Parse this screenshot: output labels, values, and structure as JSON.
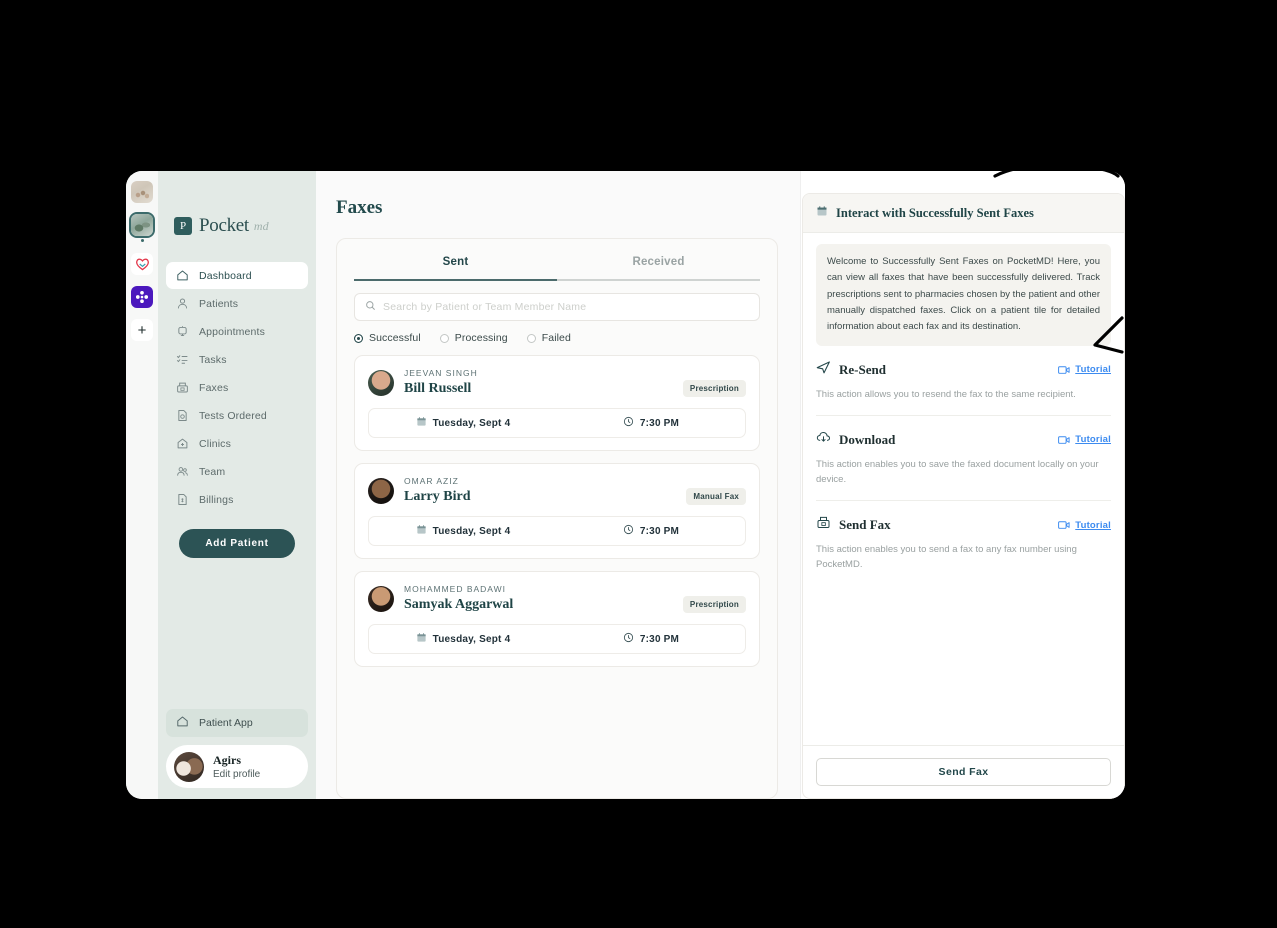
{
  "colors": {
    "brand_teal": "#2c5355",
    "sidebar_bg": "#e3eae6",
    "accent_link": "#3c8bf0",
    "badge_bg": "#efefea",
    "purple_tile": "#4b18bd"
  },
  "rail": {
    "tiles": [
      {
        "name": "workspace-thumb-1",
        "selected": false
      },
      {
        "name": "workspace-thumb-2",
        "selected": true
      },
      {
        "name": "workspace-heart-logo",
        "selected": false
      },
      {
        "name": "workspace-cross-logo",
        "selected": false
      }
    ],
    "add_label": "+"
  },
  "sidebar": {
    "logo": {
      "mark": "P",
      "text": "Pocket",
      "script": "md"
    },
    "items": [
      {
        "label": "Dashboard",
        "icon": "home-icon",
        "active": true
      },
      {
        "label": "Patients",
        "icon": "user-icon",
        "active": false
      },
      {
        "label": "Appointments",
        "icon": "calendar-clock-icon",
        "active": false
      },
      {
        "label": "Tasks",
        "icon": "checklist-icon",
        "active": false
      },
      {
        "label": "Faxes",
        "icon": "fax-icon",
        "active": false
      },
      {
        "label": "Tests Ordered",
        "icon": "lab-document-icon",
        "active": false
      },
      {
        "label": "Clinics",
        "icon": "clinic-icon",
        "active": false
      },
      {
        "label": "Team",
        "icon": "team-icon",
        "active": false
      },
      {
        "label": "Billings",
        "icon": "billing-document-icon",
        "active": false
      }
    ],
    "add_patient_label": "Add Patient",
    "patient_app_label": "Patient App",
    "profile": {
      "name": "Agirs",
      "subtitle": "Edit profile"
    }
  },
  "main": {
    "page_title": "Faxes",
    "tabs": [
      {
        "label": "Sent",
        "active": true
      },
      {
        "label": "Received",
        "active": false
      }
    ],
    "search": {
      "value": "",
      "placeholder": "Search by Patient or Team Member Name"
    },
    "filters": [
      {
        "label": "Successful",
        "selected": true
      },
      {
        "label": "Processing",
        "selected": false
      },
      {
        "label": "Failed",
        "selected": false
      }
    ],
    "faxes": [
      {
        "sender": "JEEVAN SINGH",
        "patient": "Bill Russell",
        "badge": "Prescription",
        "date": "Tuesday, Sept 4",
        "time": "7:30 PM"
      },
      {
        "sender": "OMAR AZIZ",
        "patient": "Larry Bird",
        "badge": "Manual Fax",
        "date": "Tuesday, Sept 4",
        "time": "7:30 PM"
      },
      {
        "sender": "MOHAMMED BADAWI",
        "patient": "Samyak Aggarwal",
        "badge": "Prescription",
        "date": "Tuesday, Sept 4",
        "time": "7:30 PM"
      }
    ]
  },
  "right_panel": {
    "header_title": "Interact with Successfully Sent Faxes",
    "header_icon": "calendar-icon",
    "welcome": "Welcome to Successfully Sent Faxes on PocketMD! Here, you can view all faxes that have been successfully delivered. Track prescriptions sent to pharmacies chosen by the patient and other manually dispatched faxes. Click on a patient tile for detailed information about each fax and its destination.",
    "actions": [
      {
        "title": "Re-Send",
        "icon": "paper-plane-icon",
        "description": "This action allows you to resend the fax to the same recipient.",
        "tutorial_label": "Tutorial"
      },
      {
        "title": "Download",
        "icon": "cloud-download-icon",
        "description": "This action enables you to save the faxed document locally on your device.",
        "tutorial_label": "Tutorial"
      },
      {
        "title": "Send Fax",
        "icon": "fax-icon",
        "description": "This action enables you to send a fax to any fax number using PocketMD.",
        "tutorial_label": "Tutorial"
      }
    ],
    "send_fax_label": "Send Fax"
  }
}
